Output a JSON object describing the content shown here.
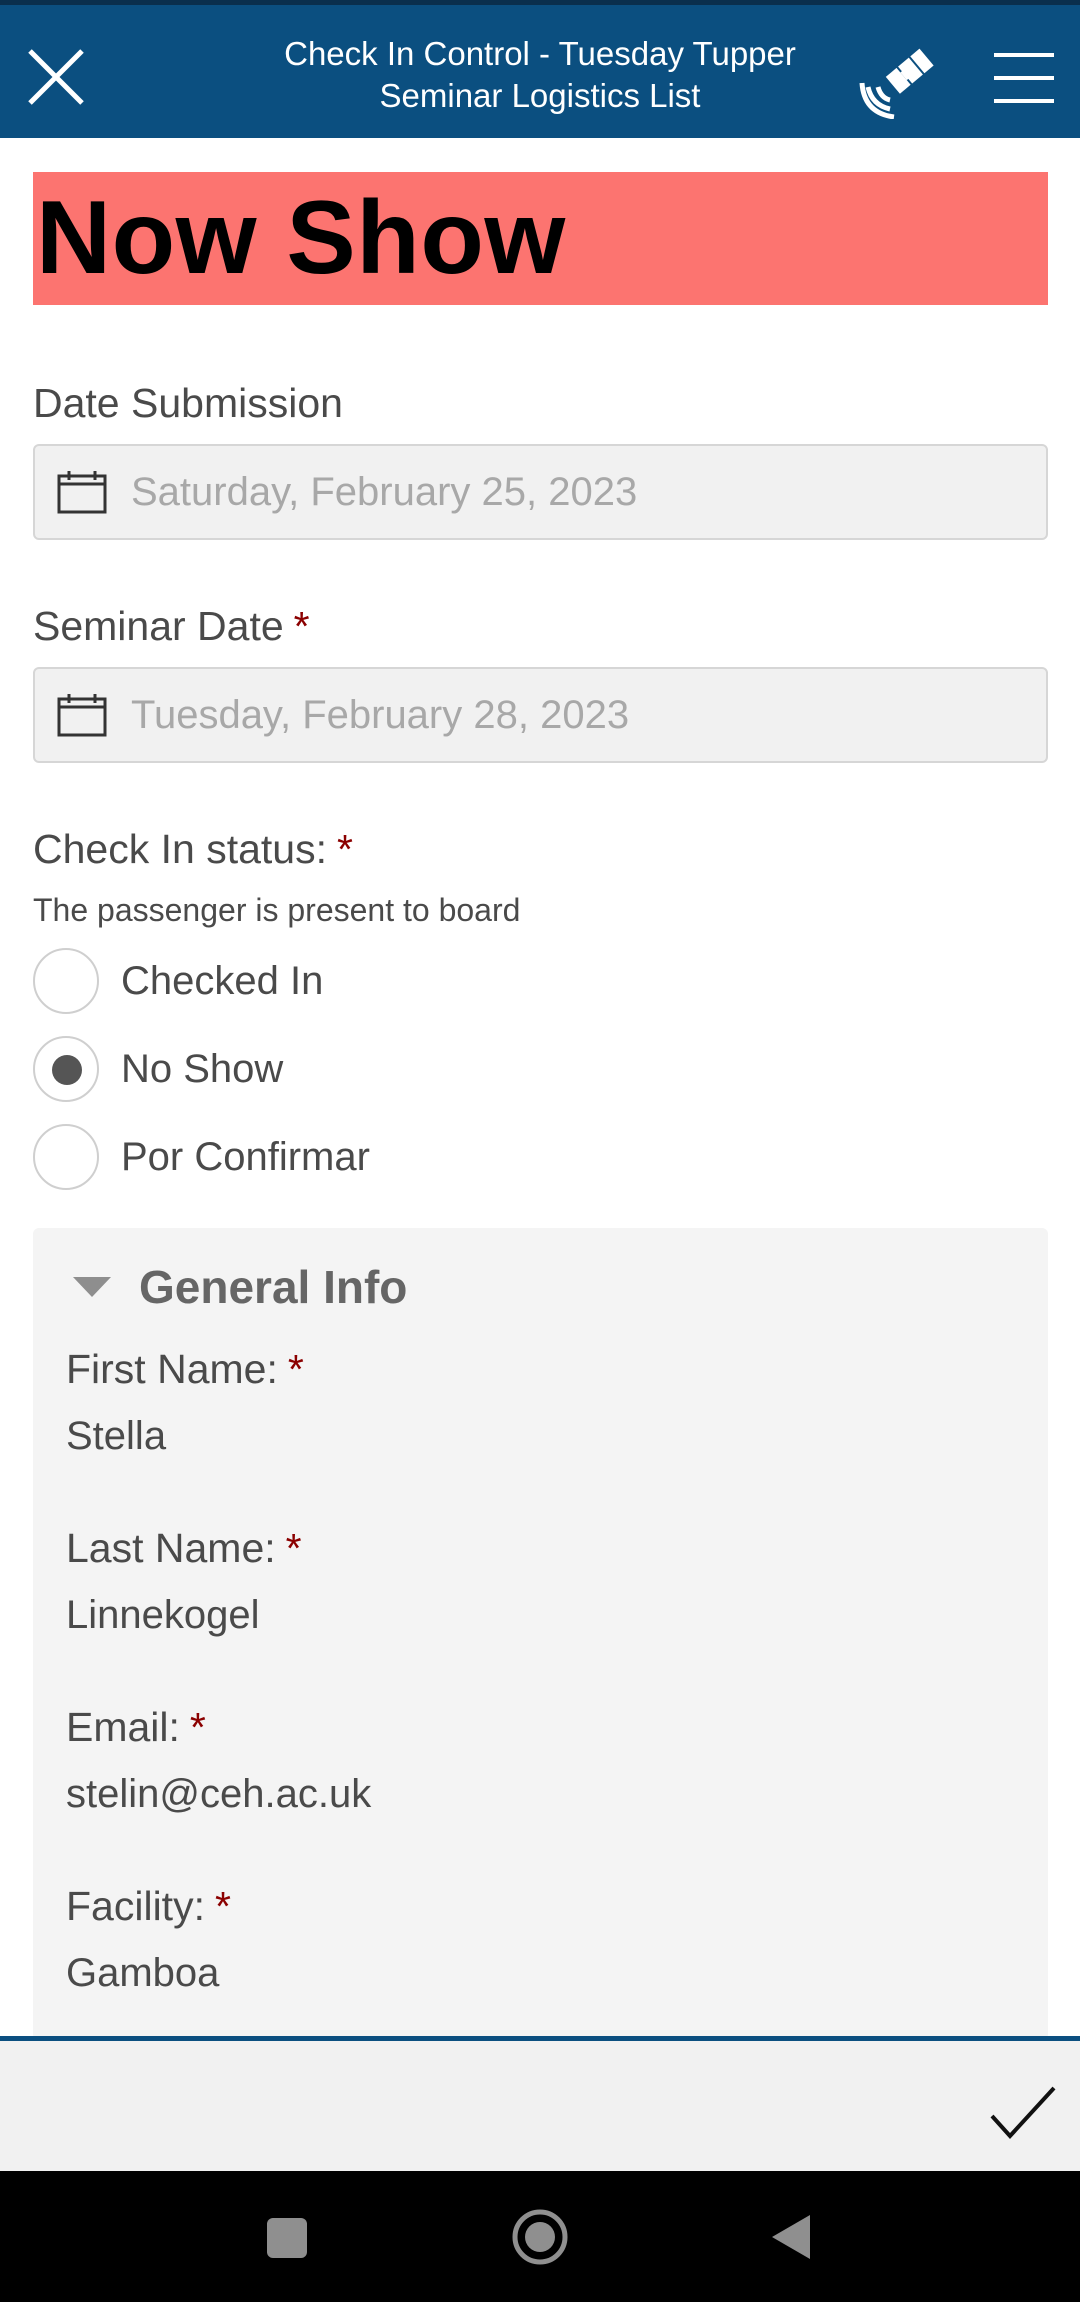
{
  "header": {
    "title_line1": "Check In Control - Tuesday Tupper",
    "title_line2": "Seminar Logistics List",
    "icons": {
      "close": "close-icon",
      "gps": "satellite-icon",
      "menu": "hamburger-menu-icon"
    }
  },
  "banner": {
    "text": "Now Show",
    "color": "#fc7470"
  },
  "date_submission": {
    "label": "Date Submission",
    "value": "Saturday, February 25, 2023"
  },
  "seminar_date": {
    "label": "Seminar Date",
    "required": "*",
    "value": "Tuesday, February 28, 2023"
  },
  "check_in_status": {
    "label": "Check In status:",
    "required": "*",
    "hint": "The passenger is present to board",
    "options": [
      "Checked In",
      "No Show",
      "Por Confirmar"
    ],
    "selected": "No Show"
  },
  "general_info": {
    "title": "General Info",
    "fields": [
      {
        "label": "First Name:",
        "required": "*",
        "value": "Stella"
      },
      {
        "label": "Last Name:",
        "required": "*",
        "value": "Linnekogel"
      },
      {
        "label": "Email:",
        "required": "*",
        "value": "stelin@ceh.ac.uk"
      },
      {
        "label": "Facility:",
        "required": "*",
        "value": "Gamboa"
      }
    ]
  },
  "footer": {
    "icon": "checkmark-icon"
  },
  "colors": {
    "header": "#0b4f80",
    "required": "#8b0000",
    "group_bg": "#f4f4f4"
  }
}
